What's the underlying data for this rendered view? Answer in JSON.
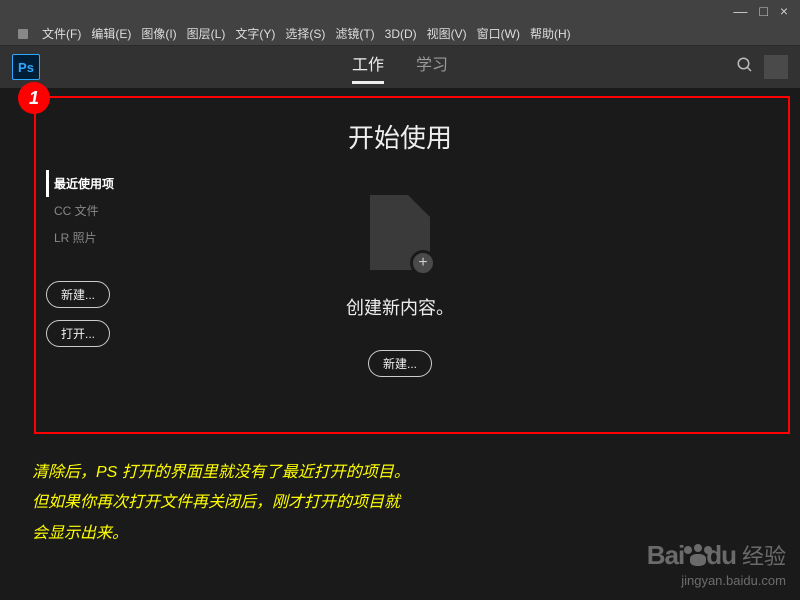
{
  "window": {
    "controls": {
      "min": "—",
      "max": "□",
      "close": "×"
    }
  },
  "menubar": [
    "文件(F)",
    "编辑(E)",
    "图像(I)",
    "图层(L)",
    "文字(Y)",
    "选择(S)",
    "滤镜(T)",
    "3D(D)",
    "视图(V)",
    "窗口(W)",
    "帮助(H)"
  ],
  "app": {
    "logo": "Ps"
  },
  "tabs": {
    "work": "工作",
    "learn": "学习",
    "active": "work"
  },
  "annotation": {
    "badge": "1"
  },
  "sidebar": {
    "items": [
      {
        "label": "最近使用项",
        "active": true
      },
      {
        "label": "CC 文件",
        "active": false
      },
      {
        "label": "LR 照片",
        "active": false
      }
    ],
    "new_btn": "新建...",
    "open_btn": "打开..."
  },
  "start": {
    "title": "开始使用",
    "subtitle": "创建新内容。",
    "new_btn": "新建..."
  },
  "caption": {
    "line1": "清除后，PS 打开的界面里就没有了最近打开的项目。",
    "line2": "但如果你再次打开文件再关闭后，刚才打开的项目就",
    "line3": "会显示出来。"
  },
  "watermark": {
    "brand": "Bai",
    "brand2": "du",
    "text": "经验",
    "url": "jingyan.baidu.com"
  }
}
